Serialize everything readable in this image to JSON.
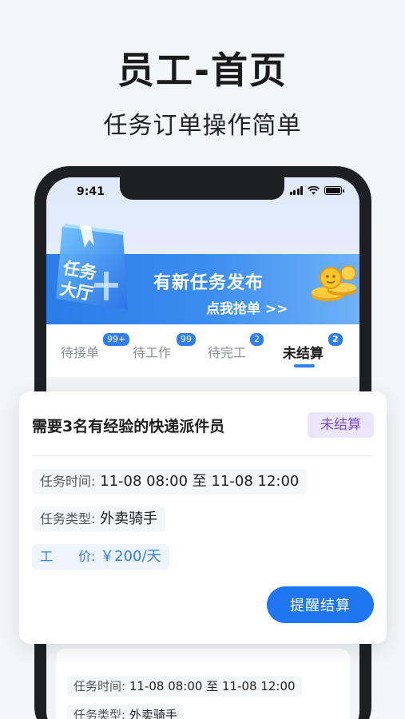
{
  "hero": {
    "title": "员工-首页",
    "subtitle": "任务订单操作简单"
  },
  "status_bar": {
    "time": "9:41",
    "icons": [
      "signal-icon",
      "wifi-icon",
      "battery-icon"
    ]
  },
  "banner": {
    "book_label_line1": "任务",
    "book_label_line2": "大厅",
    "headline": "有新任务发布",
    "cta": "点我抢单 >>",
    "colors": {
      "start": "#2c7be8",
      "end": "#6fb2f7"
    }
  },
  "tabs": [
    {
      "label": "待接单",
      "badge": "99+"
    },
    {
      "label": "待工作",
      "badge": "99"
    },
    {
      "label": "待完工",
      "badge": "2"
    },
    {
      "label": "未结算",
      "badge": "2",
      "active": true
    }
  ],
  "order_card": {
    "title": "需要3名有经验的快递派件员",
    "status": "未结算",
    "time_label": "任务时间:",
    "time_value": "11-08 08:00 至 11-08 12:00",
    "type_label": "任务类型:",
    "type_value": "外卖骑手",
    "price_label": "工　　价:",
    "price_value": "￥200/天",
    "action": "提醒结算"
  },
  "bg_card": {
    "time_label": "任务时间:",
    "time_value": "11-08 08:00 至 11-08 12:00",
    "type_label": "任务类型:",
    "type_value": "外卖骑手"
  },
  "colors": {
    "accent": "#1f76f0",
    "badge_bg": "#ebe6fb",
    "badge_text": "#7a4cd6"
  }
}
